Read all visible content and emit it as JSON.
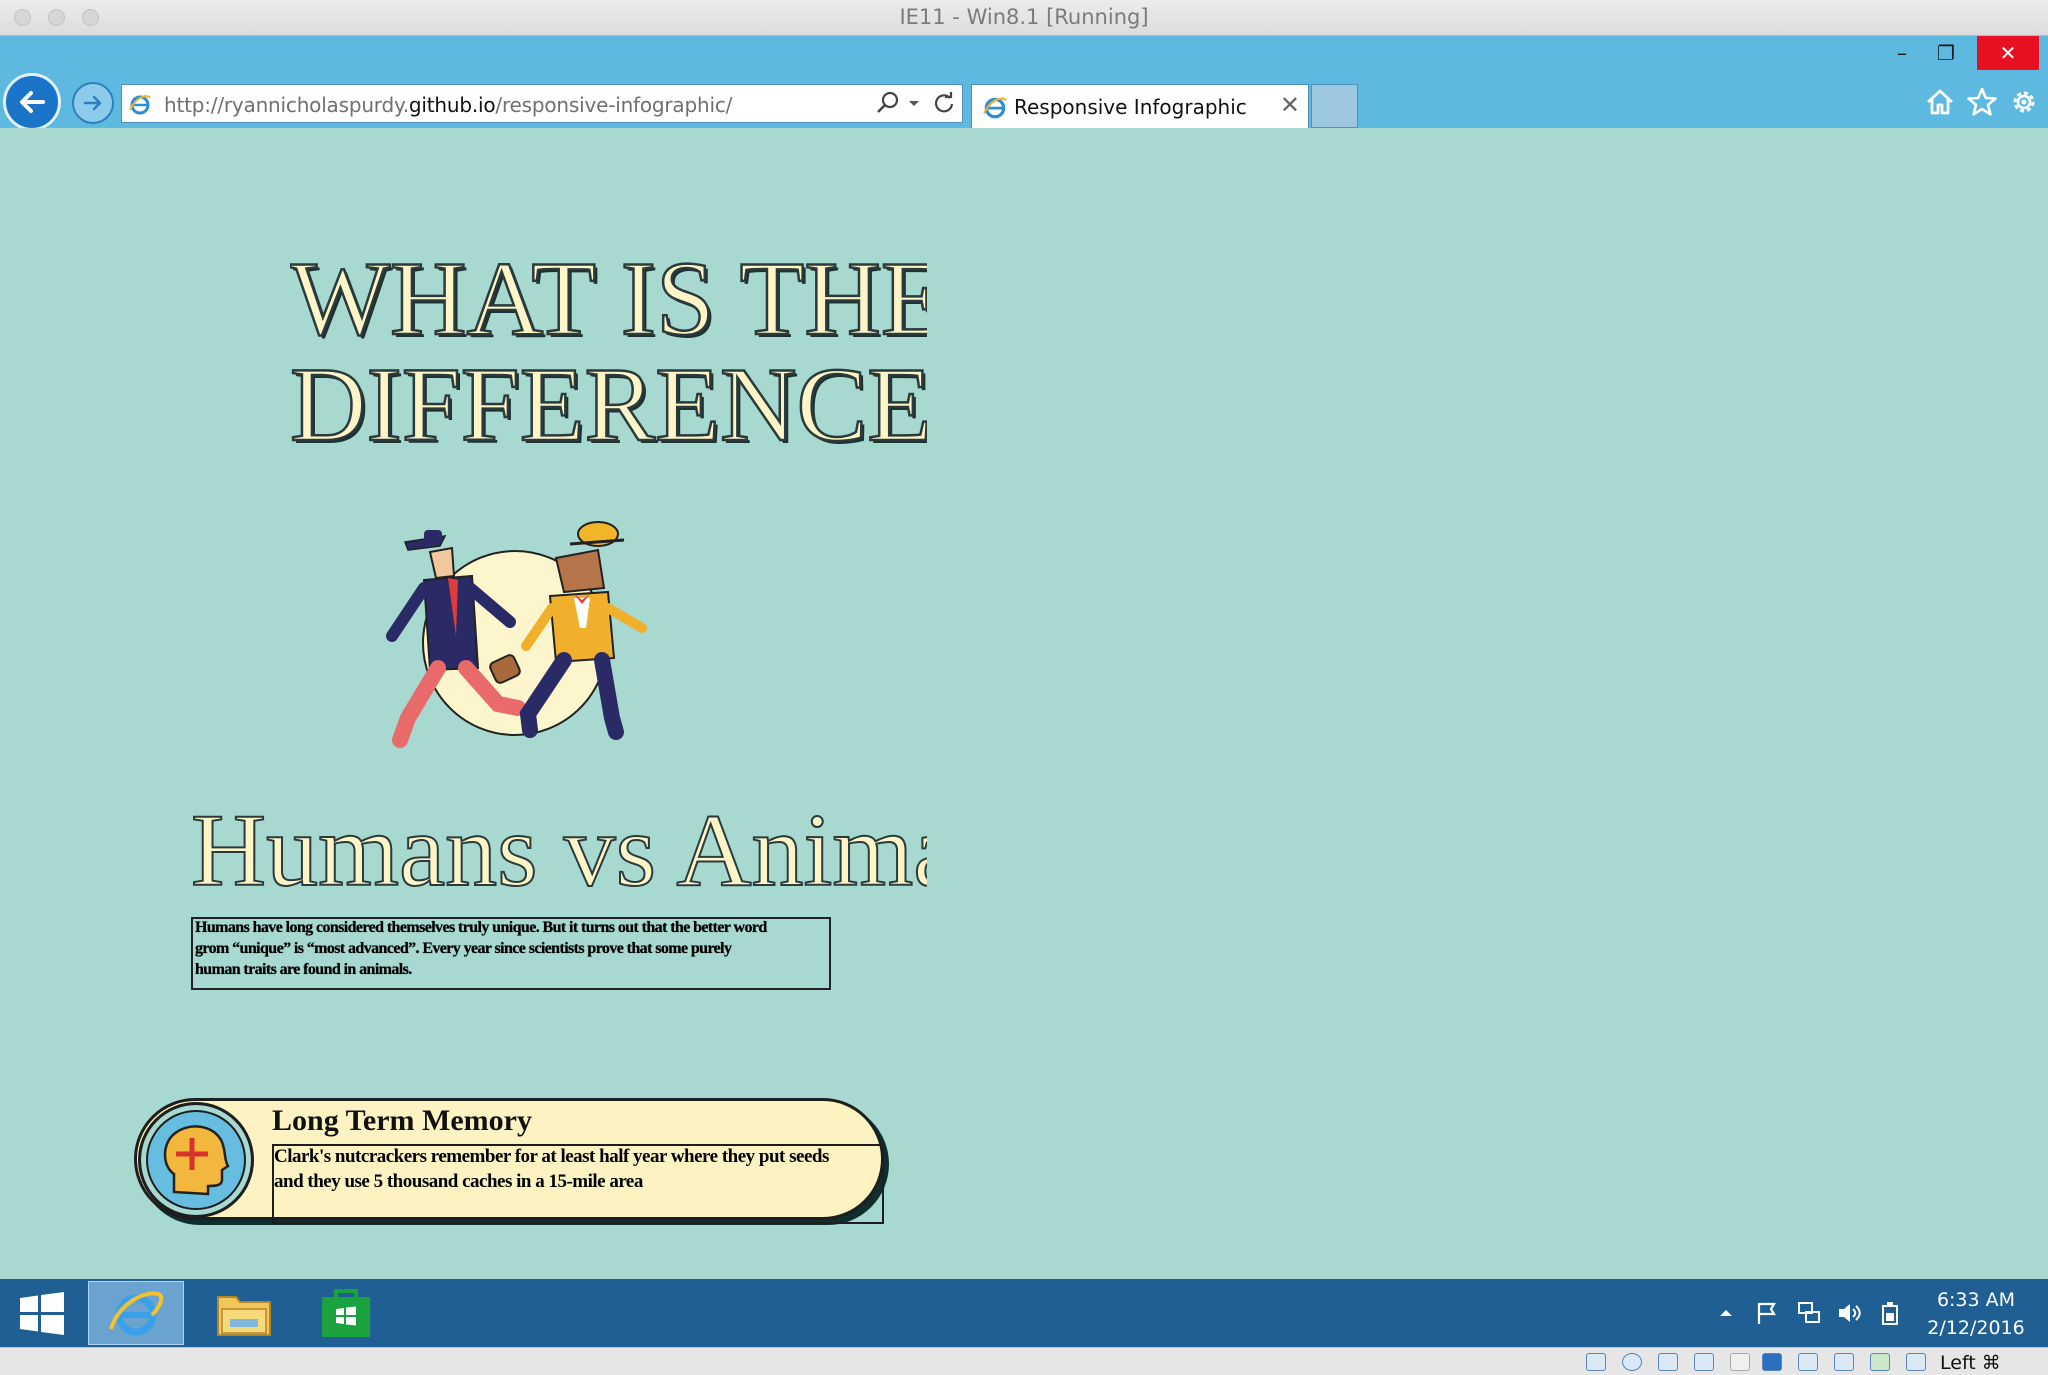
{
  "host": {
    "window_title": "IE11 - Win8.1 [Running]",
    "host_key_label": "Left ⌘"
  },
  "browser": {
    "address": {
      "prefix": "http://ryannicholaspurdy.",
      "domain": "github.io",
      "suffix": "/responsive-infographic/"
    },
    "tab": {
      "title": "Responsive Infographic",
      "close_glyph": "✕"
    },
    "window_controls": {
      "minimize": "–",
      "restore": "❐",
      "close": "✕"
    },
    "icons": [
      "home-icon",
      "favorites-star-icon",
      "settings-gear-icon"
    ]
  },
  "page": {
    "headline_line1": "WHAT IS THE",
    "headline_line2": "DIFFERENCE",
    "subheading": "Humans vs Animals",
    "intro_text": "Humans have long considered themselves truly unique. But it turns out that the better word grom “unique” is “most advanced”. Every year since scientists prove that some purely human traits are found in animals.",
    "cards": [
      {
        "title": "Long Term Memory",
        "body": "Clark's nutcrackers remember for at least half year where they put seeds and they use 5 thousand caches in a 15-mile area",
        "icon": "head-plus-icon"
      }
    ],
    "colors": {
      "background": "#a7d9d1",
      "headline_fill": "#fdf4c8",
      "card_fill": "#fdf3c2",
      "icon_circle": "#66bde0"
    }
  },
  "taskbar": {
    "apps": [
      "start-icon",
      "internet-explorer-icon",
      "file-explorer-icon",
      "store-icon"
    ],
    "time": "6:33 AM",
    "date": "2/12/2016"
  }
}
